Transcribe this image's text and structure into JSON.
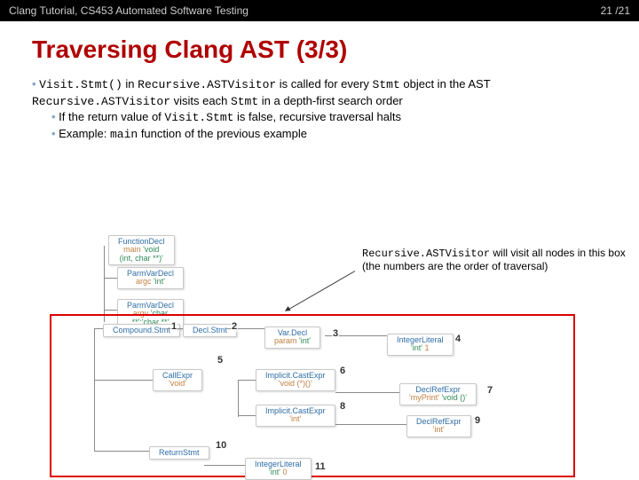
{
  "header": {
    "title": "Clang Tutorial, CS453 Automated Software Testing",
    "page": "21 /21"
  },
  "slide": {
    "title": "Traversing Clang AST (3/3)"
  },
  "bullets": {
    "b1_seg1": "Visit.Stmt()",
    "b1_seg2": " in ",
    "b1_seg3": "Recursive.ASTVisitor",
    "b1_seg4": " is called for every ",
    "b1_seg5": "Stmt",
    "b1_seg6": " object in the AST  ",
    "b1_seg7": "Recursive.ASTVisitor",
    "b1_seg8": " visits each ",
    "b1_seg9": "Stmt",
    "b1_seg10": " in a depth-first search order",
    "b2_seg1": "If the return value of ",
    "b2_seg2": "Visit.Stmt",
    "b2_seg3": " is false, recursive traversal halts",
    "b3_seg1": "Example: ",
    "b3_seg2": "main",
    "b3_seg3": " function of the previous example"
  },
  "callout": {
    "seg1": "Recursive.ASTVisitor",
    "seg2": " will visit all nodes in this box (the numbers are the order of traversal)"
  },
  "nodes": {
    "fndecl": {
      "label": "FunctionDecl",
      "sub_name": "main",
      "sub_type": "'void (int, char **)'"
    },
    "pvd1": {
      "label": "ParmVarDecl",
      "sub_name": "argc",
      "sub_type": "'int'"
    },
    "pvd2": {
      "label": "ParmVarDecl",
      "sub_name": "argv",
      "sub_type": "'char **':'char **'"
    },
    "compound": {
      "label": "Compound.Stmt"
    },
    "declstmt": {
      "label": "Decl.Stmt"
    },
    "vardecl": {
      "label": "Var.Decl",
      "sub_name": "param",
      "sub_type": "'int'"
    },
    "intlit1": {
      "label": "IntegerLiteral",
      "sub_type": "'int'",
      "sub_val": "1"
    },
    "callexpr": {
      "label": "CallExpr",
      "sub_type": "'void'"
    },
    "cast1": {
      "label": "Implicit.CastExpr",
      "sub_type": "'void (*)()'"
    },
    "declref1": {
      "label": "DeclRefExpr",
      "sub_name": "'myPrint'",
      "sub_type": "'void ()'"
    },
    "cast2": {
      "label": "Implicit.CastExpr",
      "sub_type": "'int'"
    },
    "declref2": {
      "label": "DeclRefExpr",
      "sub_type": "'int'"
    },
    "returnstmt": {
      "label": "ReturnStmt"
    },
    "intlit2": {
      "label": "IntegerLiteral",
      "sub_type": "'int'",
      "sub_val": "0"
    }
  },
  "numbers": {
    "n1": "1",
    "n2": "2",
    "n3": "3",
    "n4": "4",
    "n5": "5",
    "n6": "6",
    "n7": "7",
    "n8": "8",
    "n9": "9",
    "n10": "10",
    "n11": "11"
  }
}
